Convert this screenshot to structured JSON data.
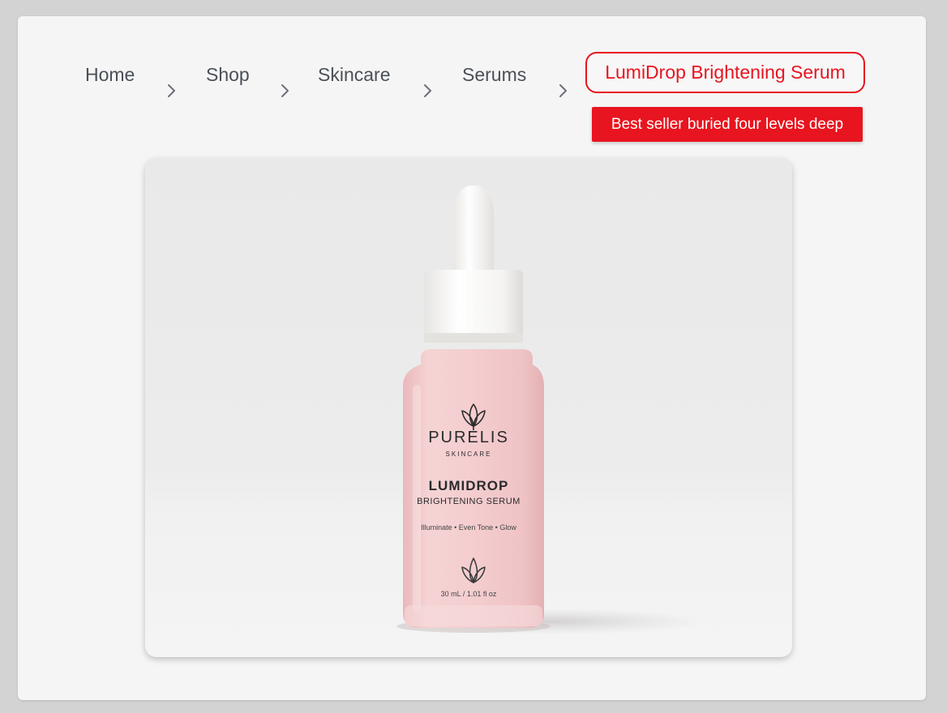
{
  "breadcrumb": {
    "items": [
      {
        "label": "Home"
      },
      {
        "label": "Shop"
      },
      {
        "label": "Skincare"
      },
      {
        "label": "Serums"
      }
    ],
    "current": "LumiDrop Brightening Serum",
    "separator_icon": "chevron-right-icon"
  },
  "callout": {
    "text": "Best seller buried four levels deep"
  },
  "product_image": {
    "brand": "PURELIS",
    "brand_sub": "SKINCARE",
    "name": "LUMIDROP",
    "subtitle": "BRIGHTENING SERUM",
    "benefits": "Illuminate • Even Tone • Glow",
    "volume": "30 mL / 1.01 fl oz"
  },
  "colors": {
    "accent": "#e8141f",
    "crumb_text": "#4a5058",
    "bottle": "#f2c9cb"
  }
}
